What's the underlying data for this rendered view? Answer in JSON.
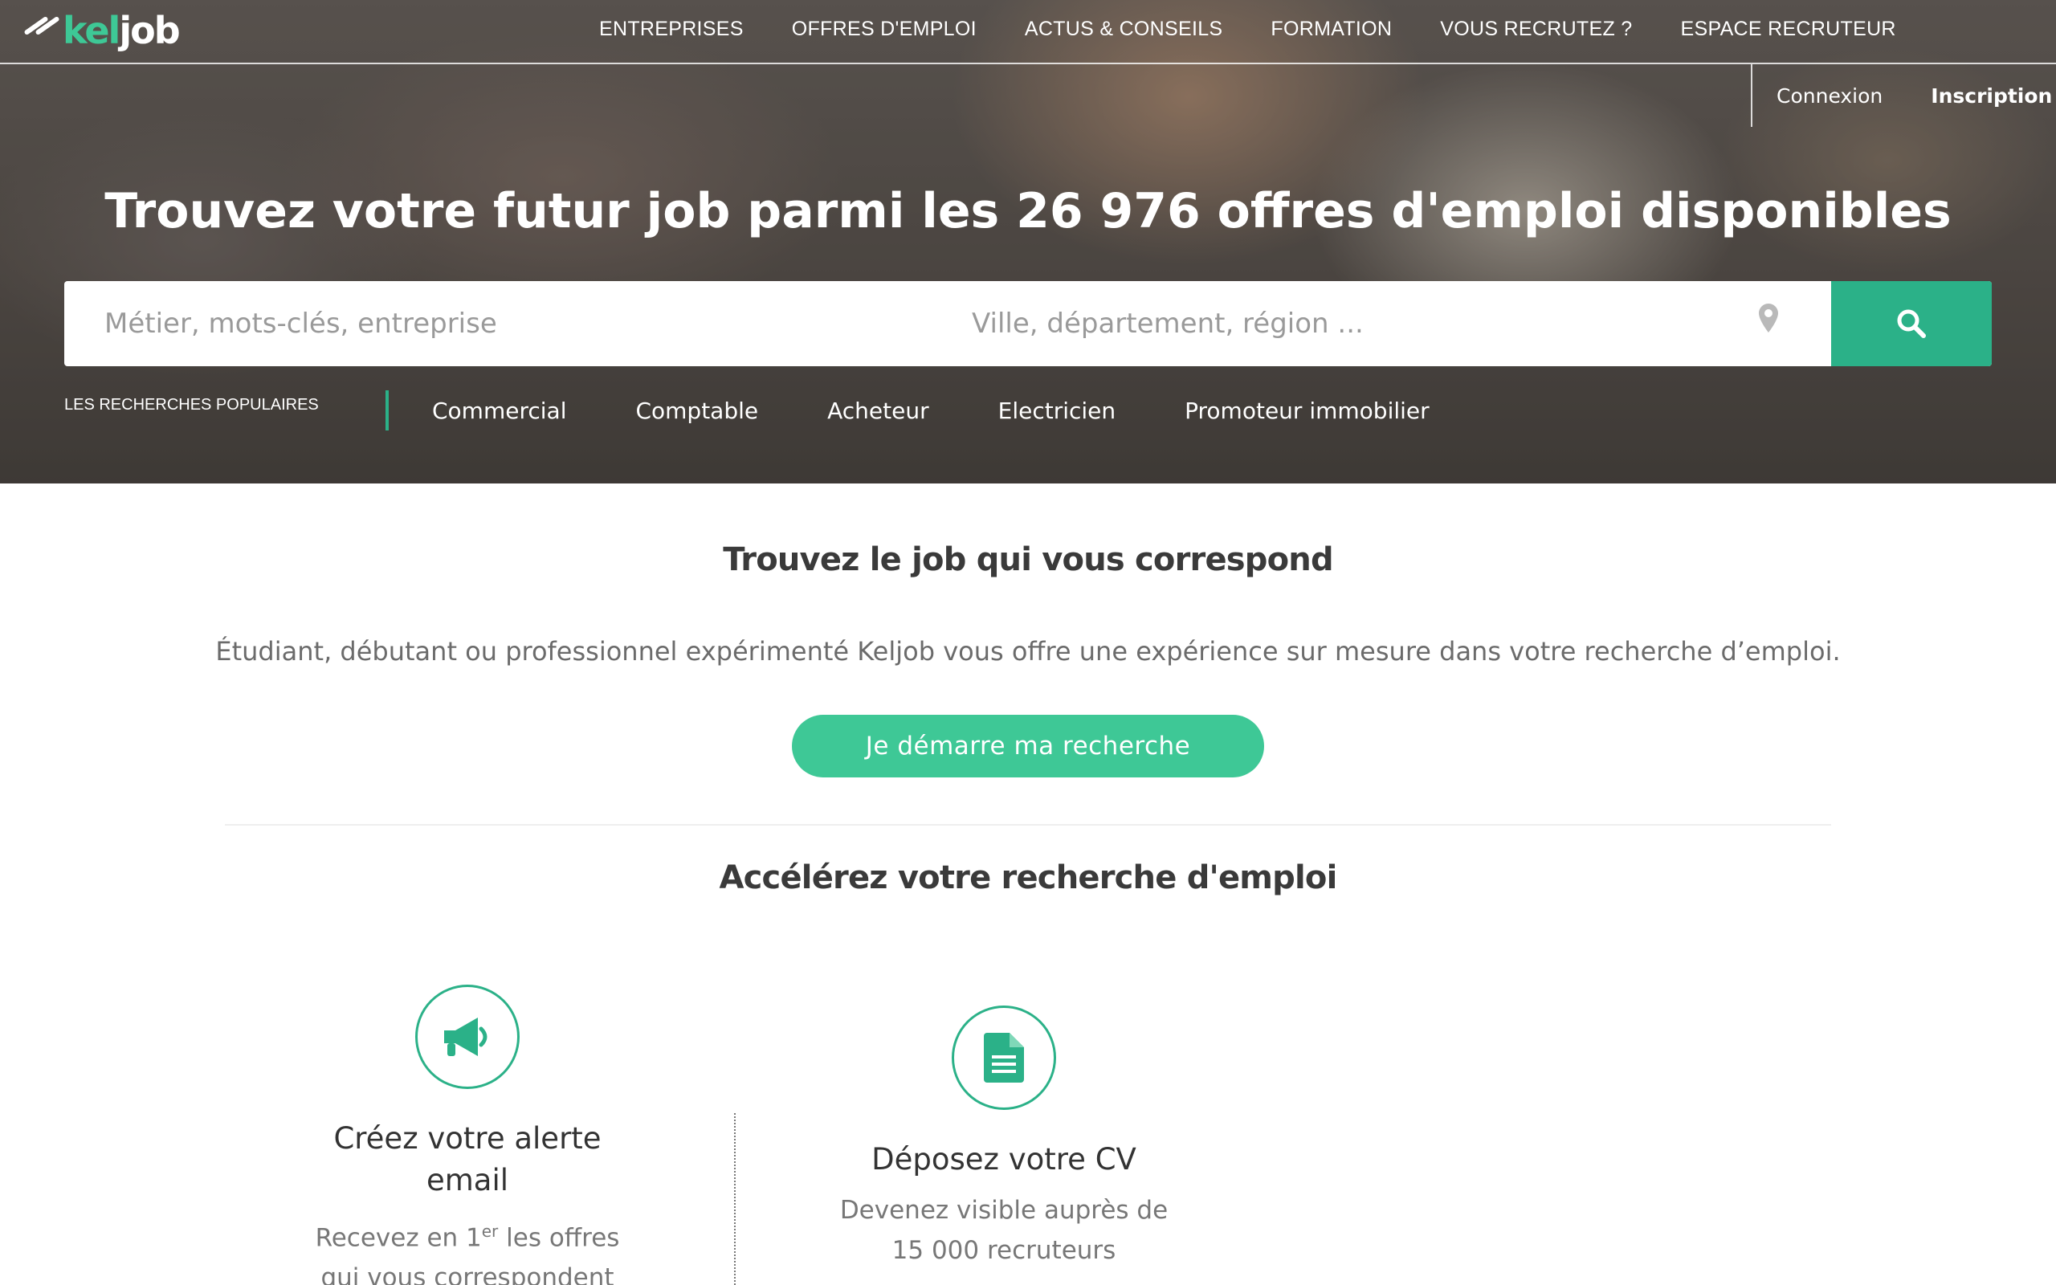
{
  "brand": {
    "logo_part1": "kel",
    "logo_part2": "job",
    "accent_color": "#3ec896",
    "dark_accent_color": "#2bb188"
  },
  "nav": {
    "items": [
      {
        "label": "ENTREPRISES"
      },
      {
        "label": "OFFRES D'EMPLOI"
      },
      {
        "label": "ACTUS & CONSEILS"
      },
      {
        "label": "FORMATION"
      },
      {
        "label": "VOUS RECRUTEZ ?"
      },
      {
        "label": "ESPACE RECRUTEUR"
      }
    ]
  },
  "auth": {
    "login": "Connexion",
    "signup": "Inscription"
  },
  "hero": {
    "title_before": "Trouvez votre futur job parmi les ",
    "title_highlight": "26 976 offres d'emploi",
    "title_after": " disponibles",
    "search": {
      "what_placeholder": "Métier, mots-clés, entreprise",
      "where_placeholder": "Ville, département, région ...",
      "location_icon": "map-pin-icon",
      "submit_icon": "search-icon"
    },
    "popular": {
      "label": "LES RECHERCHES POPULAIRES",
      "items": [
        "Commercial",
        "Comptable",
        "Acheteur",
        "Electricien",
        "Promoteur immobilier"
      ]
    }
  },
  "find_job": {
    "title": "Trouvez le job qui vous correspond",
    "text": "Étudiant, débutant ou professionnel expérimenté Keljob vous offre une expérience sur mesure dans votre recherche d’emploi.",
    "cta_label": "Je démarre ma recherche"
  },
  "accelerate": {
    "title": "Accélérez votre recherche d'emploi",
    "features": [
      {
        "icon": "megaphone-icon",
        "title": "Créez votre alerte email",
        "text_before_sup": "Recevez en 1",
        "text_sup": "er",
        "text_after_sup": " les offres qui vous correspondent"
      },
      {
        "icon": "document-icon",
        "title": "Déposez votre CV",
        "text": "Devenez visible auprès de 15 000 recruteurs"
      }
    ]
  }
}
